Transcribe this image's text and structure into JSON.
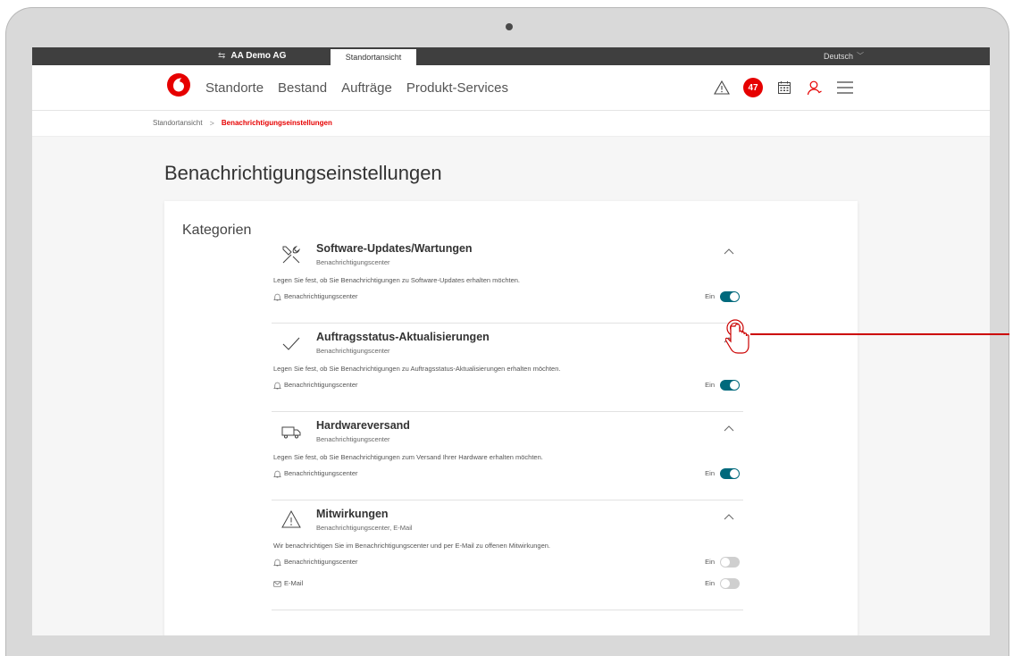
{
  "topbar": {
    "company": "AA Demo AG",
    "site_tab": "Standortansicht",
    "language": "Deutsch"
  },
  "nav": {
    "links": [
      "Standorte",
      "Bestand",
      "Aufträge",
      "Produkt-Services"
    ],
    "badge_count": "47",
    "icons": [
      "warning-icon",
      "notification-badge",
      "calendar-icon",
      "user-icon",
      "menu-icon"
    ]
  },
  "breadcrumb": {
    "parent": "Standortansicht",
    "separator": ">",
    "current": "Benachrichtigungseinstellungen"
  },
  "page": {
    "title": "Benachrichtigungseinstellungen",
    "categories_title": "Kategorien"
  },
  "sections": [
    {
      "title": "Software-Updates/Wartungen",
      "subtitle": "Benachrichtigungscenter",
      "description": "Legen Sie fest, ob Sie Benachrichtigungen zu Software-Updates erhalten möchten.",
      "icon": "tools-icon",
      "rows": [
        {
          "label": "Benachrichtigungscenter",
          "state": "Ein",
          "enabled": true,
          "icon": "bell-icon"
        }
      ]
    },
    {
      "title": "Auftragsstatus-Aktualisierungen",
      "subtitle": "Benachrichtigungscenter",
      "description": "Legen Sie fest, ob Sie Benachrichtigungen zu Auftragsstatus-Aktualisierungen erhalten möchten.",
      "icon": "checkmark-icon",
      "rows": [
        {
          "label": "Benachrichtigungscenter",
          "state": "Ein",
          "enabled": true,
          "icon": "bell-icon"
        }
      ]
    },
    {
      "title": "Hardwareversand",
      "subtitle": "Benachrichtigungscenter",
      "description": "Legen Sie fest, ob Sie Benachrichtigungen zum Versand Ihrer Hardware erhalten möchten.",
      "icon": "truck-icon",
      "rows": [
        {
          "label": "Benachrichtigungscenter",
          "state": "Ein",
          "enabled": true,
          "icon": "bell-icon"
        }
      ]
    },
    {
      "title": "Mitwirkungen",
      "subtitle": "Benachrichtigungscenter, E-Mail",
      "description": "Wir benachrichtigen Sie im Benachrichtigungscenter und per E-Mail zu offenen Mitwirkungen.",
      "icon": "warning-icon",
      "rows": [
        {
          "label": "Benachrichtigungscenter",
          "state": "Ein",
          "enabled": false,
          "icon": "bell-icon"
        },
        {
          "label": "E-Mail",
          "state": "Ein",
          "enabled": false,
          "icon": "mail-icon"
        }
      ]
    }
  ],
  "colors": {
    "brand_red": "#e60000",
    "toggle_on": "#00697c",
    "toggle_disabled": "#cfcfcf",
    "topbar": "#3f3f3f"
  }
}
